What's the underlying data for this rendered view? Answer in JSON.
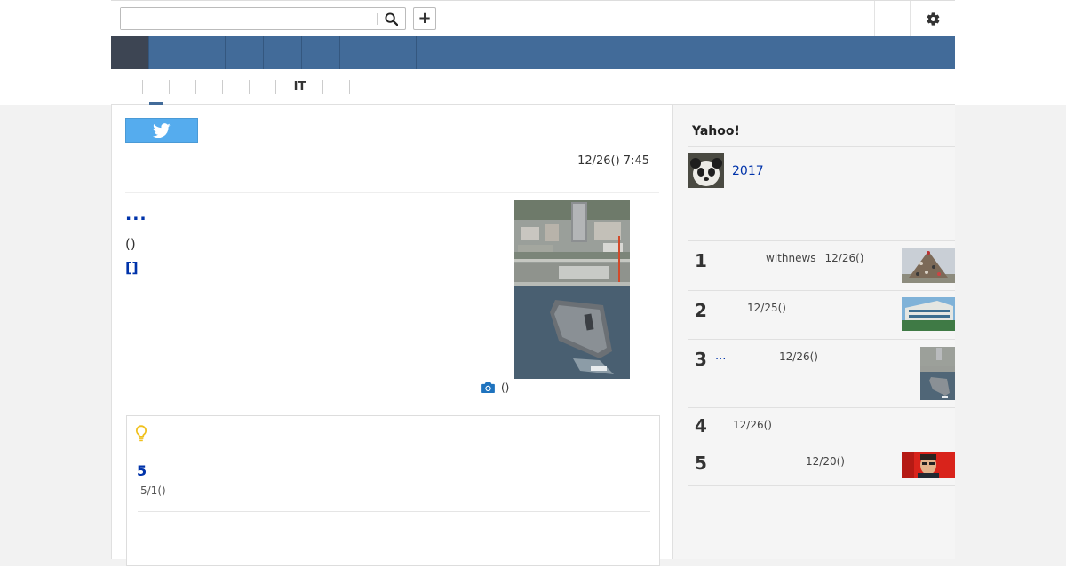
{
  "header": {
    "search": {
      "value": "",
      "placeholder": ""
    },
    "plus_label": "+",
    "icons": {
      "search": "search-icon",
      "settings": "gear-icon"
    }
  },
  "subnav": {
    "category_it": "IT"
  },
  "article": {
    "date": "12/26() 7:45",
    "title": "...",
    "source": "()",
    "link": "[]",
    "photo_caption": "()"
  },
  "related": {
    "number": "5",
    "date": "5/1()"
  },
  "sidebar": {
    "heading": "Yahoo!",
    "feature_link": "2017",
    "ranking": [
      {
        "rank": "1",
        "source": "withnews",
        "date": "12/26()"
      },
      {
        "rank": "2",
        "source": "",
        "date": "12/25()"
      },
      {
        "rank": "3",
        "prefix": "...",
        "date": "12/26()"
      },
      {
        "rank": "4",
        "date": "12/26()"
      },
      {
        "rank": "5",
        "date": "12/20()"
      }
    ]
  },
  "colors": {
    "nav_blue": "#426b99",
    "nav_active": "#3d4553",
    "link_blue": "#0033aa",
    "twitter": "#55acee",
    "bulb": "#f0c01c",
    "camera": "#1e73be"
  }
}
